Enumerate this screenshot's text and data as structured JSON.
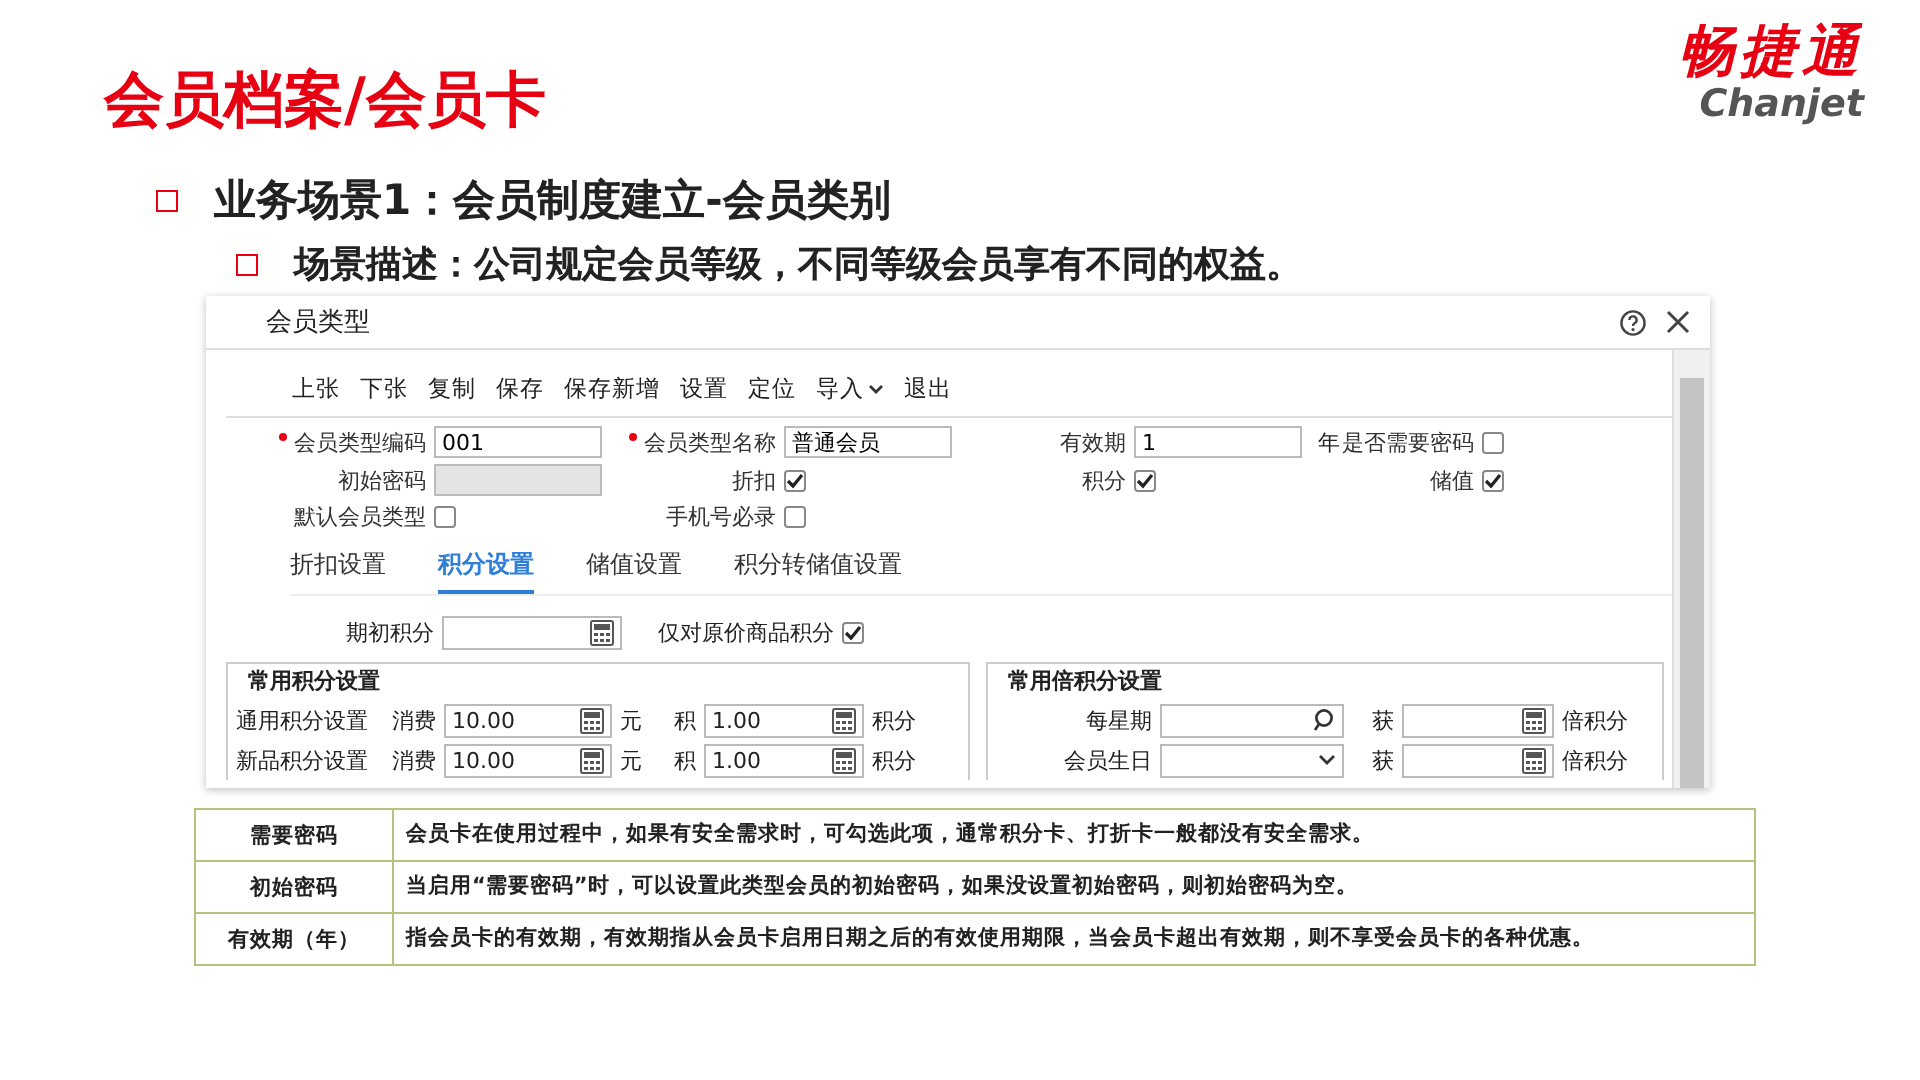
{
  "title": "会员档案/会员卡",
  "logo": {
    "name": "畅捷通",
    "latin": "Chanjet"
  },
  "bullets": [
    {
      "text": "业务场景1：会员制度建立-会员类别",
      "children": [
        {
          "text": "场景描述：公司规定会员等级，不同等级会员享有不同的权益。"
        }
      ]
    }
  ],
  "dialog": {
    "title": "会员类型",
    "toolbar": [
      {
        "label": "上张",
        "menu": false
      },
      {
        "label": "下张",
        "menu": false
      },
      {
        "label": "复制",
        "menu": false
      },
      {
        "label": "保存",
        "menu": false
      },
      {
        "label": "保存新增",
        "menu": false
      },
      {
        "label": "设置",
        "menu": false
      },
      {
        "label": "定位",
        "menu": false
      },
      {
        "label": "导入",
        "menu": true
      },
      {
        "label": "退出",
        "menu": false
      }
    ],
    "form_rows": [
      [
        {
          "kind": "text",
          "label": "会员类型编码",
          "required": true,
          "value": "001",
          "disabled": false
        },
        {
          "kind": "text",
          "label": "会员类型名称",
          "required": true,
          "value": "普通会员",
          "disabled": false
        },
        {
          "kind": "text",
          "label": "有效期",
          "required": false,
          "value": "1",
          "suffix": "年",
          "disabled": false
        },
        {
          "kind": "check",
          "label": "是否需要密码",
          "checked": false
        }
      ],
      [
        {
          "kind": "text",
          "label": "初始密码",
          "required": false,
          "disabled": true
        },
        {
          "kind": "check",
          "label": "折扣",
          "checked": true
        },
        {
          "kind": "check",
          "label": "积分",
          "checked": true
        },
        {
          "kind": "check",
          "label": "储值",
          "checked": true
        }
      ],
      [
        {
          "kind": "check",
          "label": "默认会员类型",
          "checked": false
        },
        {
          "kind": "check",
          "label": "手机号必录",
          "checked": false
        }
      ]
    ],
    "tabs": [
      {
        "label": "折扣设置",
        "selected": false
      },
      {
        "label": "积分设置",
        "selected": true
      },
      {
        "label": "储值设置",
        "selected": false
      },
      {
        "label": "积分转储值设置",
        "selected": false
      }
    ],
    "opening_points": {
      "label": "期初积分"
    },
    "original_price_only": {
      "label": "仅对原价商品积分",
      "checked": true
    },
    "points_group": {
      "title": "常用积分设置",
      "rows": [
        {
          "label": "通用积分设置",
          "spend_label": "消费",
          "spend": "10.00",
          "spend_unit": "元",
          "earn_label": "积",
          "earn": "1.00",
          "earn_unit": "积分"
        },
        {
          "label": "新品积分设置",
          "spend_label": "消费",
          "spend": "10.00",
          "spend_unit": "元",
          "earn_label": "积",
          "earn": "1.00",
          "earn_unit": "积分"
        }
      ]
    },
    "multiplier_group": {
      "title": "常用倍积分设置",
      "rows": [
        {
          "label": "每星期",
          "kind": "search",
          "get_label": "获",
          "unit": "倍积分"
        },
        {
          "label": "会员生日",
          "kind": "select",
          "get_label": "获",
          "unit": "倍积分"
        }
      ]
    }
  },
  "table": {
    "rows": [
      {
        "term": "需要密码",
        "description": "会员卡在使用过程中，如果有安全需求时，可勾选此项，通常积分卡、打折卡一般都没有安全需求。"
      },
      {
        "term": "初始密码",
        "description": "当启用“需要密码”时，可以设置此类型会员的初始密码，如果没设置初始密码，则初始密码为空。"
      },
      {
        "term": "有效期（年）",
        "description": "指会员卡的有效期，有效期指从会员卡启用日期之后的有效使用期限，当会员卡超出有效期，则不享受会员卡的各种优惠。"
      }
    ]
  }
}
